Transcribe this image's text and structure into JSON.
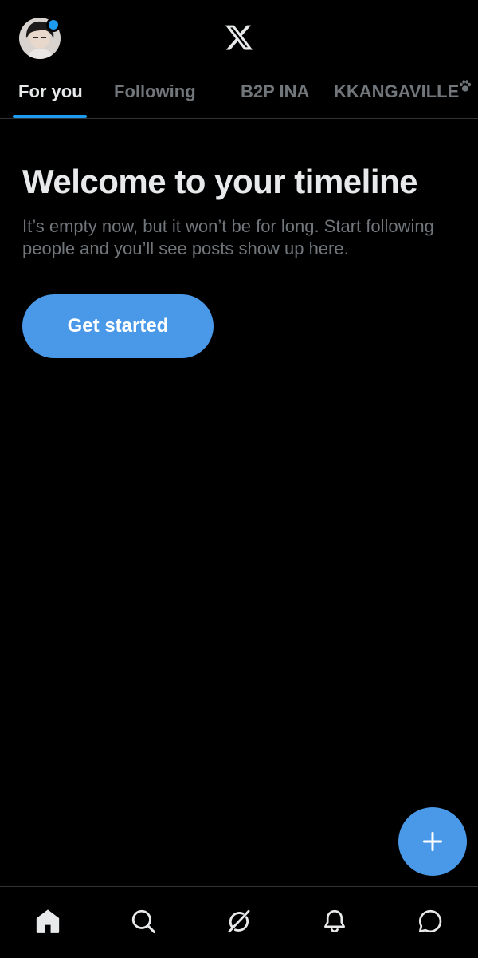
{
  "header": {
    "avatar_icon": "profile-avatar",
    "notification_dot_color": "#1d9bf0",
    "logo_icon": "x-logo-icon"
  },
  "tabs": [
    {
      "label": "For you",
      "active": true
    },
    {
      "label": "Following",
      "active": false
    },
    {
      "label": "B2P INA",
      "active": false
    },
    {
      "label": "KKANGAVILLE",
      "active": false,
      "suffix_icon": "paw-icon"
    }
  ],
  "welcome": {
    "title": "Welcome to your timeline",
    "text": "It’s empty now, but it won’t be for long. Start following people and you’ll see posts show up here.",
    "button_label": "Get started"
  },
  "fab": {
    "icon": "plus-icon"
  },
  "bottom_nav": [
    {
      "icon": "home-icon",
      "active": true
    },
    {
      "icon": "search-icon",
      "active": false
    },
    {
      "icon": "grok-icon",
      "active": false
    },
    {
      "icon": "bell-icon",
      "active": false
    },
    {
      "icon": "messages-icon",
      "active": false
    }
  ],
  "colors": {
    "background": "#000000",
    "accent": "#1d9bf0",
    "button": "#4a99e9",
    "primary_text": "#e7e9ea",
    "secondary_text": "#71767b",
    "divider": "#2f3336"
  }
}
